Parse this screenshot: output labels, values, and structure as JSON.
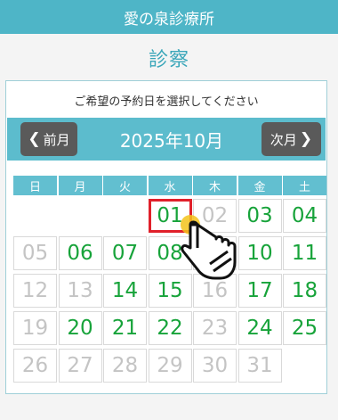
{
  "header": {
    "title": "愛の泉診療所"
  },
  "page": {
    "title": "診察"
  },
  "calendar": {
    "instruction": "ご希望の予約日を選択してください",
    "prev_label": "前月",
    "next_label": "次月",
    "month_label": "2025年10月",
    "weekdays": [
      "日",
      "月",
      "火",
      "水",
      "木",
      "金",
      "土"
    ],
    "selected_day": "01",
    "weeks": [
      [
        {
          "d": "",
          "a": false
        },
        {
          "d": "",
          "a": false
        },
        {
          "d": "",
          "a": false
        },
        {
          "d": "01",
          "a": true
        },
        {
          "d": "02",
          "a": false
        },
        {
          "d": "03",
          "a": true
        },
        {
          "d": "04",
          "a": true
        }
      ],
      [
        {
          "d": "05",
          "a": false
        },
        {
          "d": "06",
          "a": true
        },
        {
          "d": "07",
          "a": true
        },
        {
          "d": "08",
          "a": true
        },
        {
          "d": "09",
          "a": false
        },
        {
          "d": "10",
          "a": true
        },
        {
          "d": "11",
          "a": true
        }
      ],
      [
        {
          "d": "12",
          "a": false
        },
        {
          "d": "13",
          "a": false
        },
        {
          "d": "14",
          "a": true
        },
        {
          "d": "15",
          "a": true
        },
        {
          "d": "16",
          "a": false
        },
        {
          "d": "17",
          "a": true
        },
        {
          "d": "18",
          "a": true
        }
      ],
      [
        {
          "d": "19",
          "a": false
        },
        {
          "d": "20",
          "a": true
        },
        {
          "d": "21",
          "a": true
        },
        {
          "d": "22",
          "a": true
        },
        {
          "d": "23",
          "a": false
        },
        {
          "d": "24",
          "a": true
        },
        {
          "d": "25",
          "a": true
        }
      ],
      [
        {
          "d": "26",
          "a": false
        },
        {
          "d": "27",
          "a": false
        },
        {
          "d": "28",
          "a": false
        },
        {
          "d": "29",
          "a": false
        },
        {
          "d": "30",
          "a": false
        },
        {
          "d": "31",
          "a": false
        },
        {
          "d": "",
          "a": false
        }
      ]
    ]
  },
  "colors": {
    "header_bg": "#4eb5c7",
    "accent": "#5cbccd",
    "available": "#17a33a",
    "unavailable": "#c4c4c4",
    "selected_border": "#e0202a"
  },
  "icons": {
    "pointer": "hand-pointer-icon"
  }
}
